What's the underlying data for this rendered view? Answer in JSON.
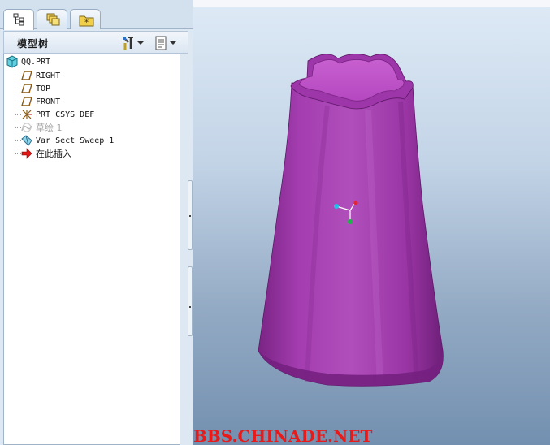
{
  "panel": {
    "tabs": [
      {
        "name": "model-tree-tab",
        "icon": "tree-structure-icon",
        "active": true
      },
      {
        "name": "folder-browser-tab",
        "icon": "layers-icon",
        "active": false
      },
      {
        "name": "favorites-tab",
        "icon": "folder-star-icon",
        "active": false
      }
    ],
    "title": "模型树",
    "header_buttons": [
      {
        "name": "settings-tools-button",
        "icon": "tools-icon"
      },
      {
        "name": "show-options-button",
        "icon": "list-icon"
      }
    ]
  },
  "tree": {
    "root": {
      "label": "QQ.PRT",
      "icon": "part-icon"
    },
    "items": [
      {
        "label": "RIGHT",
        "icon": "datum-plane-icon"
      },
      {
        "label": "TOP",
        "icon": "datum-plane-icon"
      },
      {
        "label": "FRONT",
        "icon": "datum-plane-icon"
      },
      {
        "label": "PRT_CSYS_DEF",
        "icon": "csys-icon"
      },
      {
        "label": "草绘 1",
        "icon": "sketch-icon",
        "suppressed": true
      },
      {
        "label": "Var Sect Sweep 1",
        "icon": "sweep-feature-icon"
      },
      {
        "label": "在此插入",
        "icon": "insert-here-arrow-icon"
      }
    ]
  },
  "viewport": {
    "watermark": "BBS.CHINADE.NET",
    "model_color": "#9c3aa6",
    "axis_colors": {
      "x": "#e2263a",
      "y": "#22b14c",
      "z": "#23c0e8"
    }
  }
}
